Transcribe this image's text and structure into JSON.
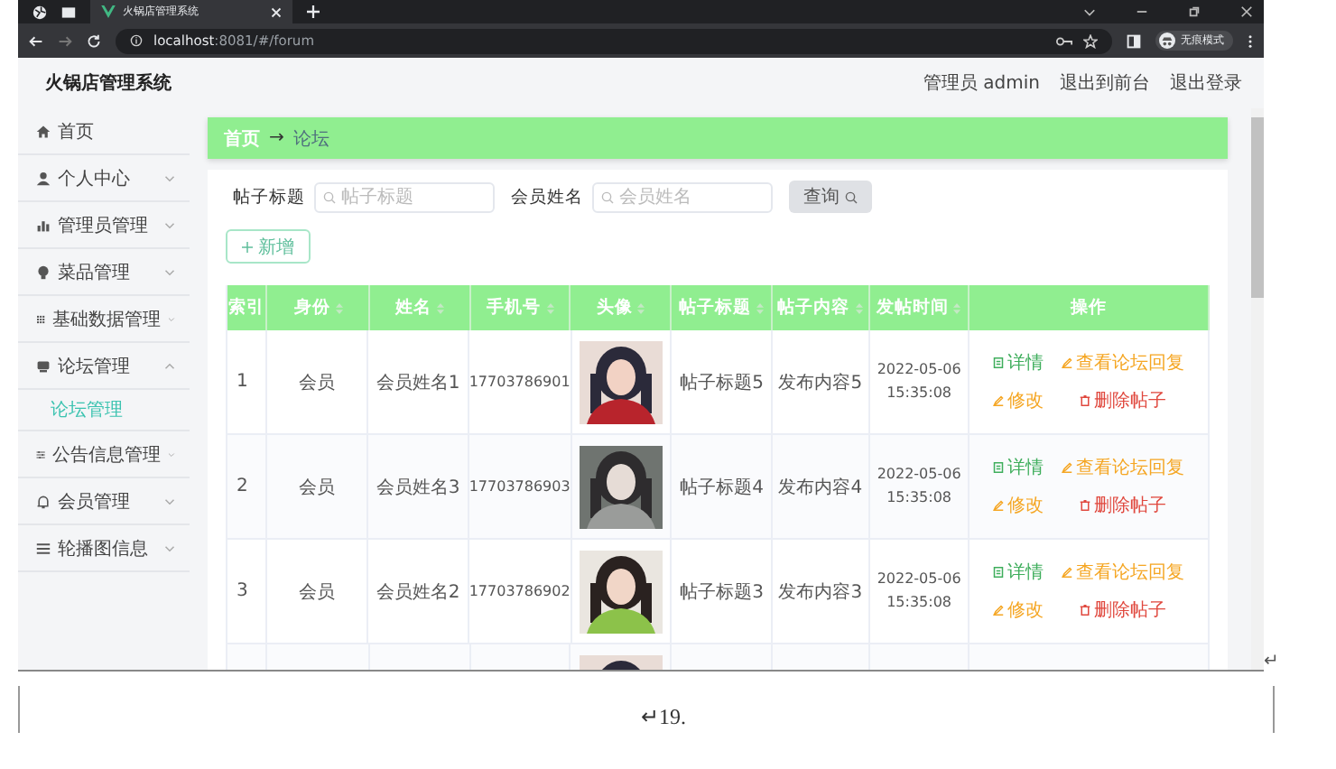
{
  "browser": {
    "tab_title": "火锅店管理系统",
    "url_host": "localhost",
    "url_path": ":8081/#/forum",
    "profile_label": "无痕模式"
  },
  "header": {
    "title": "火锅店管理系统",
    "user": "管理员 admin",
    "links": [
      "退出到前台",
      "退出登录"
    ]
  },
  "sidebar": {
    "items": [
      {
        "label": "首页",
        "kind": "link"
      },
      {
        "label": "个人中心",
        "kind": "menu",
        "expanded": false
      },
      {
        "label": "管理员管理",
        "kind": "menu",
        "expanded": false
      },
      {
        "label": "菜品管理",
        "kind": "menu",
        "expanded": false
      },
      {
        "label": "基础数据管理",
        "kind": "menu",
        "expanded": false
      },
      {
        "label": "论坛管理",
        "kind": "menu",
        "expanded": true,
        "children": [
          {
            "label": "论坛管理",
            "selected": true
          }
        ]
      },
      {
        "label": "公告信息管理",
        "kind": "menu",
        "expanded": false
      },
      {
        "label": "会员管理",
        "kind": "menu",
        "expanded": false
      },
      {
        "label": "轮播图信息",
        "kind": "menu",
        "expanded": false
      }
    ]
  },
  "breadcrumb": {
    "home": "首页",
    "separator": "→",
    "current": "论坛"
  },
  "search": {
    "fields": [
      {
        "label": "帖子标题",
        "placeholder": "帖子标题"
      },
      {
        "label": "会员姓名",
        "placeholder": "会员姓名"
      }
    ],
    "button": "查询"
  },
  "add_button": "新增",
  "table": {
    "columns": [
      {
        "label": "索引",
        "sortable": false
      },
      {
        "label": "身份",
        "sortable": true
      },
      {
        "label": "姓名",
        "sortable": true
      },
      {
        "label": "手机号",
        "sortable": true
      },
      {
        "label": "头像",
        "sortable": true
      },
      {
        "label": "帖子标题",
        "sortable": true
      },
      {
        "label": "帖子内容",
        "sortable": true
      },
      {
        "label": "发帖时间",
        "sortable": true
      },
      {
        "label": "操作",
        "sortable": false
      }
    ],
    "rows": [
      {
        "cells": [
          "1",
          "会员",
          "会员姓名1",
          "17703786901"
        ],
        "avatar": {
          "kind": "picture"
        },
        "cells_after": [
          "帖子标题5",
          "发布内容5",
          "2022-05-06 15:35:08"
        ],
        "actions": [
          {
            "label": "详情",
            "kind": "detail"
          },
          {
            "label": "查看论坛回复",
            "kind": "edit"
          },
          {
            "label": "修改",
            "kind": "edit"
          },
          {
            "label": "删除帖子",
            "kind": "delete"
          }
        ]
      },
      {
        "cells": [
          "2",
          "会员",
          "会员姓名3",
          "17703786903"
        ],
        "avatar": {
          "kind": "picture"
        },
        "cells_after": [
          "帖子标题4",
          "发布内容4",
          "2022-05-06 15:35:08"
        ],
        "actions": [
          {
            "label": "详情",
            "kind": "detail"
          },
          {
            "label": "查看论坛回复",
            "kind": "edit"
          },
          {
            "label": "修改",
            "kind": "edit"
          },
          {
            "label": "删除帖子",
            "kind": "delete"
          }
        ]
      },
      {
        "cells": [
          "3",
          "会员",
          "会员姓名2",
          "17703786902"
        ],
        "avatar": {
          "kind": "picture"
        },
        "cells_after": [
          "帖子标题3",
          "发布内容3",
          "2022-05-06 15:35:08"
        ],
        "actions": [
          {
            "label": "详情",
            "kind": "detail"
          },
          {
            "label": "查看论坛回复",
            "kind": "edit"
          },
          {
            "label": "修改",
            "kind": "edit"
          },
          {
            "label": "删除帖子",
            "kind": "delete"
          }
        ]
      },
      {
        "cells": [],
        "avatar": {
          "kind": "picture"
        },
        "cells_after": [],
        "actions": []
      }
    ]
  },
  "document": {
    "line_mark": "↵",
    "caption": "↵19."
  }
}
